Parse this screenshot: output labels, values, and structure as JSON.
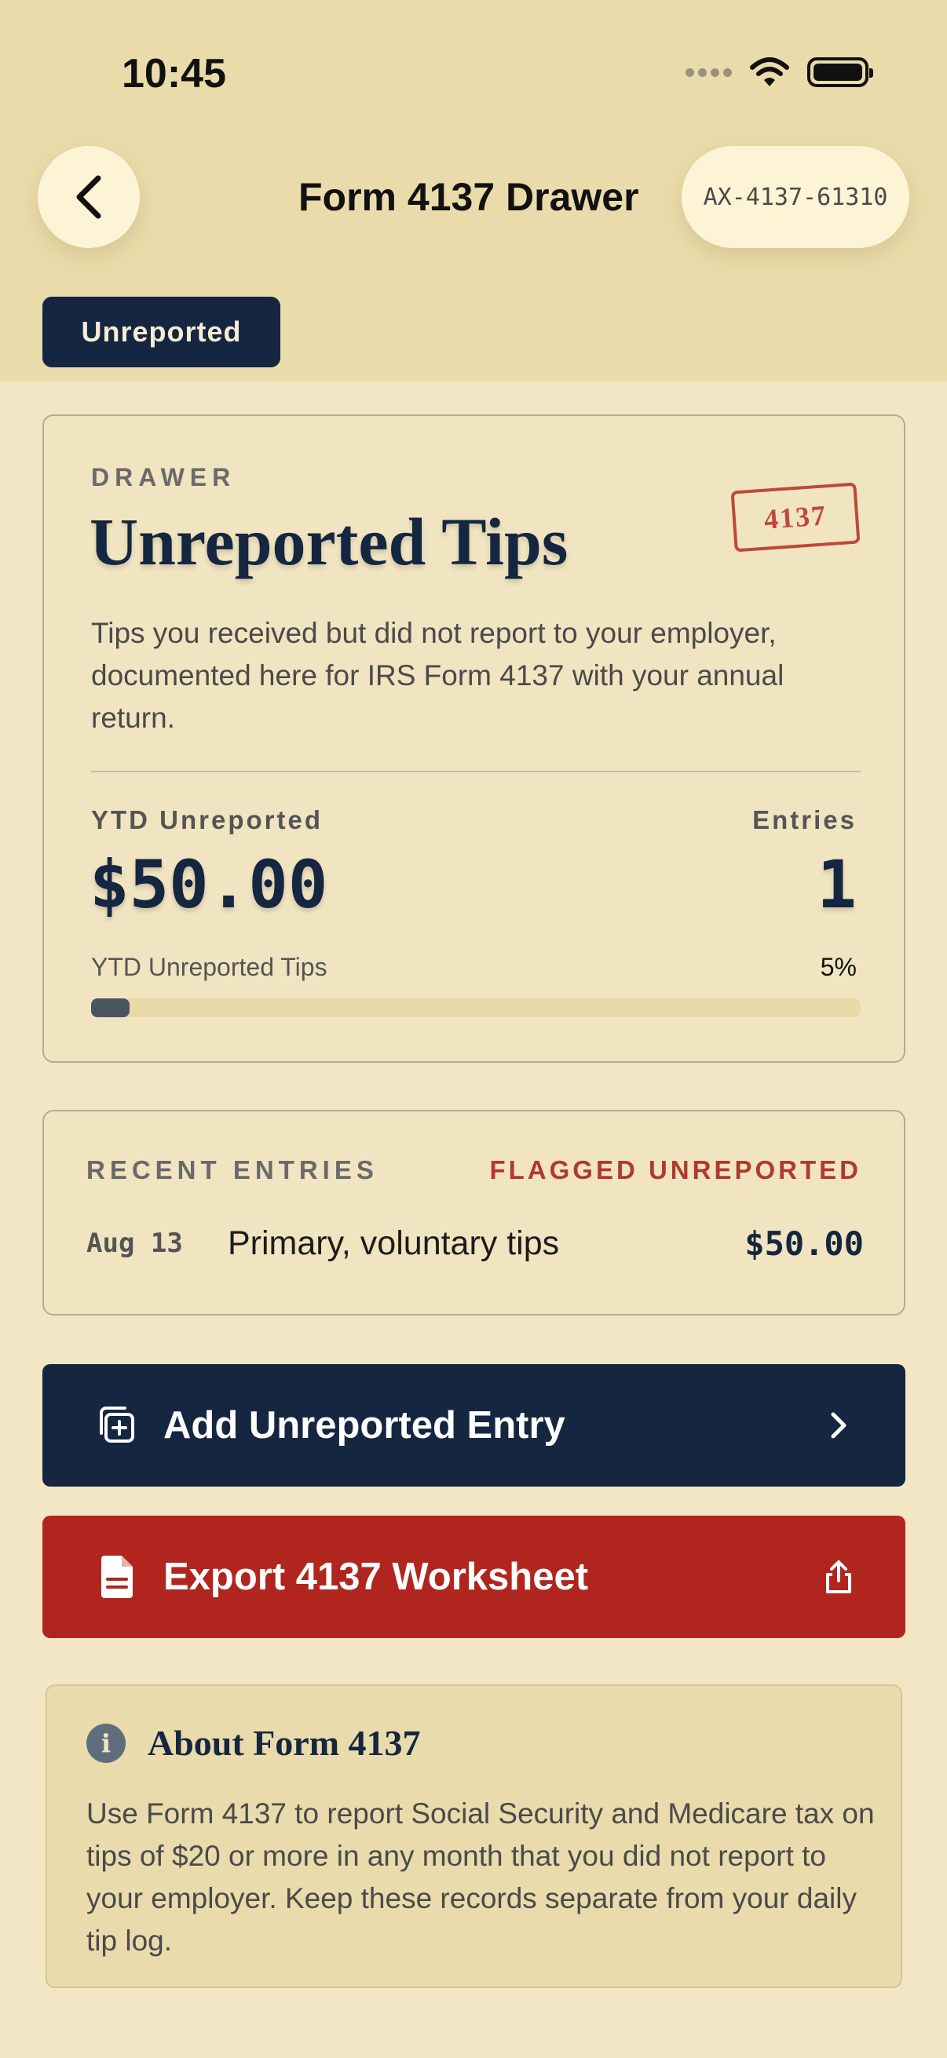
{
  "status_bar": {
    "time": "10:45",
    "icons": [
      "signal-dots-icon",
      "wifi-icon",
      "battery-icon"
    ]
  },
  "nav": {
    "title": "Form 4137 Drawer",
    "case_id": "AX-4137-61310",
    "back_icon": "chevron-left-icon"
  },
  "filter_chip": {
    "label": "Unreported"
  },
  "summary_card": {
    "eyebrow": "DRAWER",
    "title": "Unreported Tips",
    "stamp": "4137",
    "description": "Tips you received but did not report to your employer, documented here for IRS Form 4137 with your annual return.",
    "ytd_label": "YTD Unreported",
    "ytd_value": "$50.00",
    "entries_label": "Entries",
    "entries_value": "1",
    "progress_label": "YTD Unreported Tips",
    "progress_percent_text": "5%",
    "progress_fraction": 0.05
  },
  "recent_card": {
    "heading": "RECENT ENTRIES",
    "flag": "FLAGGED UNREPORTED",
    "entries": [
      {
        "date": "Aug 13",
        "description": "Primary, voluntary tips",
        "amount": "$50.00"
      }
    ]
  },
  "actions": {
    "add_label": "Add Unreported Entry",
    "export_label": "Export 4137 Worksheet"
  },
  "about": {
    "title": "About Form 4137",
    "body": "Use Form 4137 to report Social Security and Medicare tax on tips of $20 or more in any month that you did not report to your employer. Keep these records separate from your daily tip log."
  },
  "colors": {
    "navy": "#152640",
    "red": "#b0261f",
    "background": "#f3e6c4",
    "header": "#eadcaa"
  }
}
